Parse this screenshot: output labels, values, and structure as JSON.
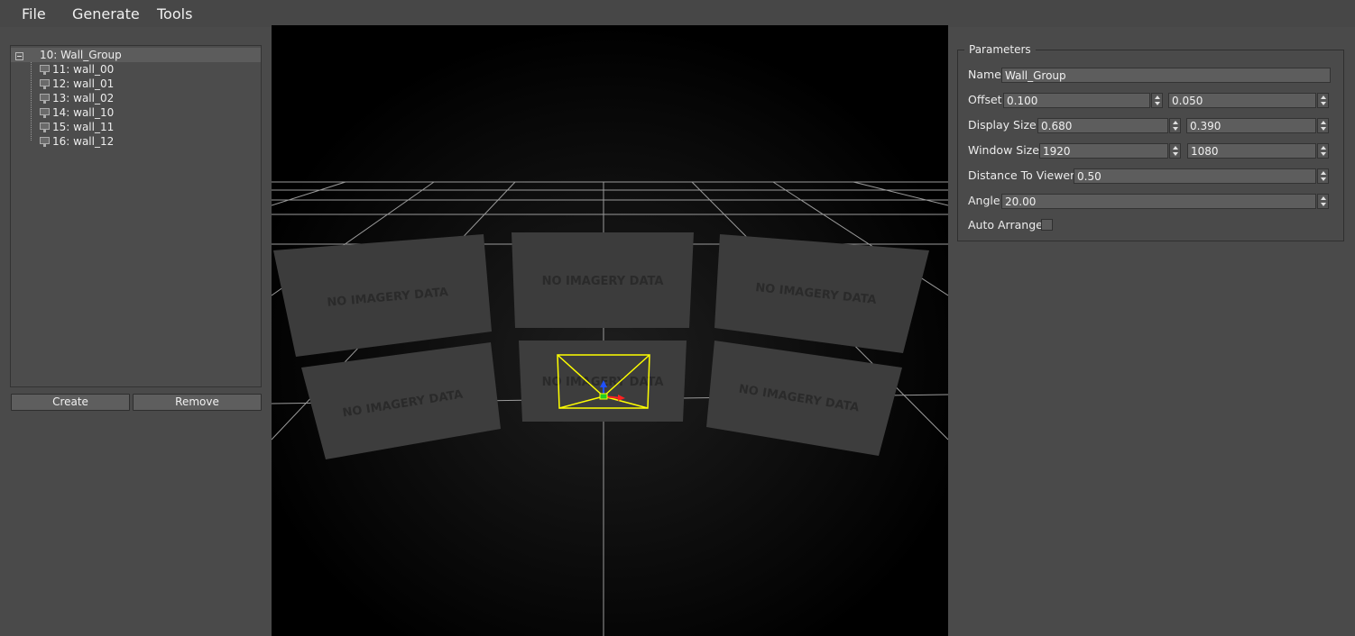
{
  "menu": {
    "file": "File",
    "generate": "Generate",
    "tools": "Tools"
  },
  "tree": {
    "root": "10: Wall_Group",
    "children": [
      "11: wall_00",
      "12: wall_01",
      "13: wall_02",
      "14: wall_10",
      "15: wall_11",
      "16: wall_12"
    ]
  },
  "buttons": {
    "create": "Create",
    "remove": "Remove"
  },
  "viewport": {
    "panel_text": "NO IMAGERY DATA"
  },
  "parameters": {
    "title": "Parameters",
    "name_label": "Name",
    "name_value": "Wall_Group",
    "offset_label": "Offset",
    "offset_x": "0.100",
    "offset_y": "0.050",
    "display_size_label": "Display Size",
    "display_w": "0.680",
    "display_h": "0.390",
    "window_size_label": "Window Size",
    "window_w": "1920",
    "window_h": "1080",
    "distance_label": "Distance To Viewer",
    "distance_value": "0.50",
    "angle_label": "Angle",
    "angle_value": "20.00",
    "auto_arrange_label": "Auto Arrange",
    "auto_arrange_checked": false
  },
  "colors": {
    "selection_outline": "#ffff00",
    "axis_x": "#ff2020",
    "axis_y": "#22cc22",
    "axis_z": "#2050ff"
  }
}
